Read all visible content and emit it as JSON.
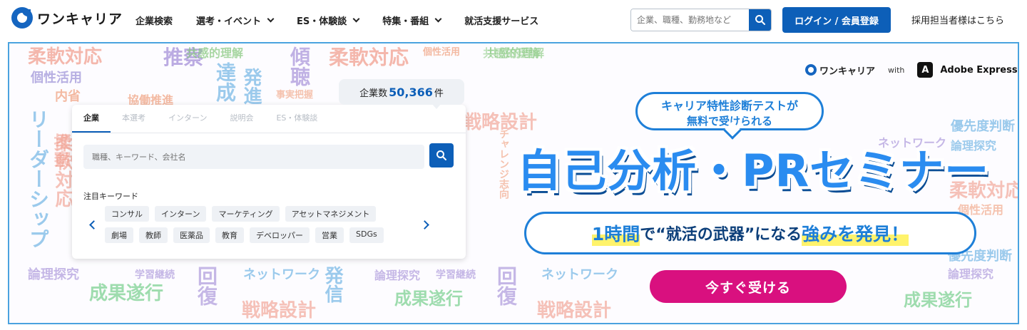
{
  "header": {
    "logo_text": "ワンキャリア",
    "nav": [
      {
        "label": "企業検索",
        "dropdown": false
      },
      {
        "label": "選考・イベント",
        "dropdown": true
      },
      {
        "label": "ES・体験談",
        "dropdown": true
      },
      {
        "label": "特集・番組",
        "dropdown": true
      },
      {
        "label": "就活支援サービス",
        "dropdown": false
      }
    ],
    "search_placeholder": "企業、職種、勤務地など",
    "login_label": "ログイン / 会員登録",
    "employer_link": "採用担当者様はこちら"
  },
  "banner": {
    "brand": "ワンキャリア",
    "with": "with",
    "adobe_mark": "A",
    "partner": "Adobe Express",
    "bubble_line1": "キャリア特性診断テストが",
    "bubble_line2_a": "無料",
    "bubble_line2_b": "で受けられる",
    "title": "自己分析・PRセミナー",
    "tagline_a": "1時間",
    "tagline_b": "で“就活の武器”になる",
    "tagline_c": "強みを発見！",
    "cta": "今すぐ受ける",
    "background_words": [
      "柔軟対応",
      "個性活用",
      "推察",
      "共感的理解",
      "傾聴",
      "達成",
      "発進",
      "協働推進",
      "内省",
      "リーダーシップ",
      "論理探究",
      "学習継続",
      "成果遂行",
      "戦略設計",
      "ネットワーク",
      "発信",
      "回復",
      "優先度判断",
      "事実把握",
      "チャレンジ志向",
      "創造的発想"
    ]
  },
  "panel": {
    "company_count_prefix": "企業数",
    "company_count": "50,366",
    "company_count_suffix": "件",
    "tabs": [
      "企業",
      "本選考",
      "インターン",
      "説明会",
      "ES・体験談"
    ],
    "active_tab": "企業",
    "search_placeholder": "職種、キーワード、会社名",
    "keywords_title": "注目キーワード",
    "keywords_row1": [
      "コンサル",
      "インターン",
      "マーケティング",
      "アセットマネジメント"
    ],
    "keywords_row2": [
      "劇場",
      "教師",
      "医薬品",
      "教育",
      "デベロッパー",
      "営業",
      "SDGs"
    ]
  },
  "colors": {
    "primary": "#0d5fb8",
    "cta": "#d9107f",
    "banner_border": "#4aa3df",
    "title": "#2a8cf0"
  }
}
